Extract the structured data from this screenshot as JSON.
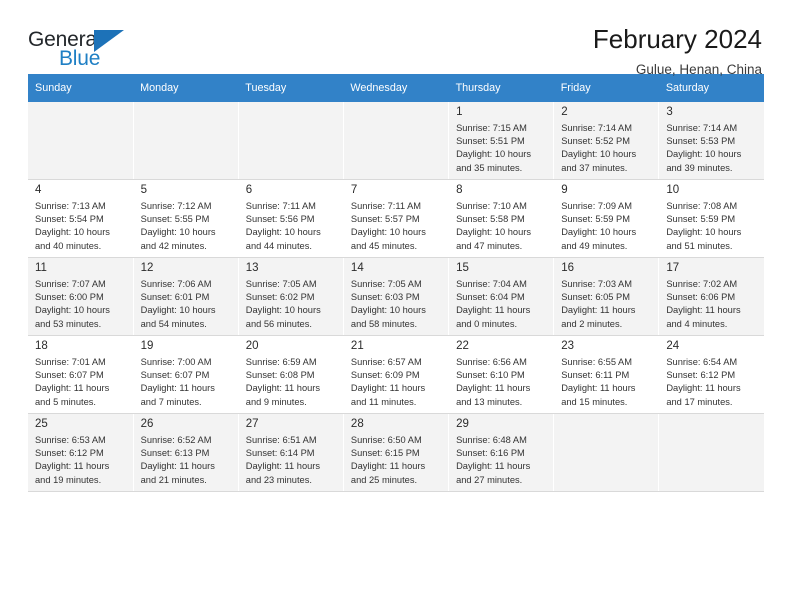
{
  "brand": {
    "name_top": "General",
    "name_bottom": "Blue",
    "accent_color": "#1f7fc4",
    "triangle_color": "#1d72b8"
  },
  "header": {
    "title": "February 2024",
    "subtitle": "Gulue, Henan, China"
  },
  "calendar": {
    "header_bg": "#3282c8",
    "weekdays": [
      "Sunday",
      "Monday",
      "Tuesday",
      "Wednesday",
      "Thursday",
      "Friday",
      "Saturday"
    ],
    "labels": {
      "sunrise": "Sunrise:",
      "sunset": "Sunset:",
      "daylight": "Daylight:"
    },
    "weeks": [
      [
        {
          "day": ""
        },
        {
          "day": ""
        },
        {
          "day": ""
        },
        {
          "day": ""
        },
        {
          "day": "1",
          "sunrise": "Sunrise: 7:15 AM",
          "sunset": "Sunset: 5:51 PM",
          "daylight1": "Daylight: 10 hours",
          "daylight2": "and 35 minutes."
        },
        {
          "day": "2",
          "sunrise": "Sunrise: 7:14 AM",
          "sunset": "Sunset: 5:52 PM",
          "daylight1": "Daylight: 10 hours",
          "daylight2": "and 37 minutes."
        },
        {
          "day": "3",
          "sunrise": "Sunrise: 7:14 AM",
          "sunset": "Sunset: 5:53 PM",
          "daylight1": "Daylight: 10 hours",
          "daylight2": "and 39 minutes."
        }
      ],
      [
        {
          "day": "4",
          "sunrise": "Sunrise: 7:13 AM",
          "sunset": "Sunset: 5:54 PM",
          "daylight1": "Daylight: 10 hours",
          "daylight2": "and 40 minutes."
        },
        {
          "day": "5",
          "sunrise": "Sunrise: 7:12 AM",
          "sunset": "Sunset: 5:55 PM",
          "daylight1": "Daylight: 10 hours",
          "daylight2": "and 42 minutes."
        },
        {
          "day": "6",
          "sunrise": "Sunrise: 7:11 AM",
          "sunset": "Sunset: 5:56 PM",
          "daylight1": "Daylight: 10 hours",
          "daylight2": "and 44 minutes."
        },
        {
          "day": "7",
          "sunrise": "Sunrise: 7:11 AM",
          "sunset": "Sunset: 5:57 PM",
          "daylight1": "Daylight: 10 hours",
          "daylight2": "and 45 minutes."
        },
        {
          "day": "8",
          "sunrise": "Sunrise: 7:10 AM",
          "sunset": "Sunset: 5:58 PM",
          "daylight1": "Daylight: 10 hours",
          "daylight2": "and 47 minutes."
        },
        {
          "day": "9",
          "sunrise": "Sunrise: 7:09 AM",
          "sunset": "Sunset: 5:59 PM",
          "daylight1": "Daylight: 10 hours",
          "daylight2": "and 49 minutes."
        },
        {
          "day": "10",
          "sunrise": "Sunrise: 7:08 AM",
          "sunset": "Sunset: 5:59 PM",
          "daylight1": "Daylight: 10 hours",
          "daylight2": "and 51 minutes."
        }
      ],
      [
        {
          "day": "11",
          "sunrise": "Sunrise: 7:07 AM",
          "sunset": "Sunset: 6:00 PM",
          "daylight1": "Daylight: 10 hours",
          "daylight2": "and 53 minutes."
        },
        {
          "day": "12",
          "sunrise": "Sunrise: 7:06 AM",
          "sunset": "Sunset: 6:01 PM",
          "daylight1": "Daylight: 10 hours",
          "daylight2": "and 54 minutes."
        },
        {
          "day": "13",
          "sunrise": "Sunrise: 7:05 AM",
          "sunset": "Sunset: 6:02 PM",
          "daylight1": "Daylight: 10 hours",
          "daylight2": "and 56 minutes."
        },
        {
          "day": "14",
          "sunrise": "Sunrise: 7:05 AM",
          "sunset": "Sunset: 6:03 PM",
          "daylight1": "Daylight: 10 hours",
          "daylight2": "and 58 minutes."
        },
        {
          "day": "15",
          "sunrise": "Sunrise: 7:04 AM",
          "sunset": "Sunset: 6:04 PM",
          "daylight1": "Daylight: 11 hours",
          "daylight2": "and 0 minutes."
        },
        {
          "day": "16",
          "sunrise": "Sunrise: 7:03 AM",
          "sunset": "Sunset: 6:05 PM",
          "daylight1": "Daylight: 11 hours",
          "daylight2": "and 2 minutes."
        },
        {
          "day": "17",
          "sunrise": "Sunrise: 7:02 AM",
          "sunset": "Sunset: 6:06 PM",
          "daylight1": "Daylight: 11 hours",
          "daylight2": "and 4 minutes."
        }
      ],
      [
        {
          "day": "18",
          "sunrise": "Sunrise: 7:01 AM",
          "sunset": "Sunset: 6:07 PM",
          "daylight1": "Daylight: 11 hours",
          "daylight2": "and 5 minutes."
        },
        {
          "day": "19",
          "sunrise": "Sunrise: 7:00 AM",
          "sunset": "Sunset: 6:07 PM",
          "daylight1": "Daylight: 11 hours",
          "daylight2": "and 7 minutes."
        },
        {
          "day": "20",
          "sunrise": "Sunrise: 6:59 AM",
          "sunset": "Sunset: 6:08 PM",
          "daylight1": "Daylight: 11 hours",
          "daylight2": "and 9 minutes."
        },
        {
          "day": "21",
          "sunrise": "Sunrise: 6:57 AM",
          "sunset": "Sunset: 6:09 PM",
          "daylight1": "Daylight: 11 hours",
          "daylight2": "and 11 minutes."
        },
        {
          "day": "22",
          "sunrise": "Sunrise: 6:56 AM",
          "sunset": "Sunset: 6:10 PM",
          "daylight1": "Daylight: 11 hours",
          "daylight2": "and 13 minutes."
        },
        {
          "day": "23",
          "sunrise": "Sunrise: 6:55 AM",
          "sunset": "Sunset: 6:11 PM",
          "daylight1": "Daylight: 11 hours",
          "daylight2": "and 15 minutes."
        },
        {
          "day": "24",
          "sunrise": "Sunrise: 6:54 AM",
          "sunset": "Sunset: 6:12 PM",
          "daylight1": "Daylight: 11 hours",
          "daylight2": "and 17 minutes."
        }
      ],
      [
        {
          "day": "25",
          "sunrise": "Sunrise: 6:53 AM",
          "sunset": "Sunset: 6:12 PM",
          "daylight1": "Daylight: 11 hours",
          "daylight2": "and 19 minutes."
        },
        {
          "day": "26",
          "sunrise": "Sunrise: 6:52 AM",
          "sunset": "Sunset: 6:13 PM",
          "daylight1": "Daylight: 11 hours",
          "daylight2": "and 21 minutes."
        },
        {
          "day": "27",
          "sunrise": "Sunrise: 6:51 AM",
          "sunset": "Sunset: 6:14 PM",
          "daylight1": "Daylight: 11 hours",
          "daylight2": "and 23 minutes."
        },
        {
          "day": "28",
          "sunrise": "Sunrise: 6:50 AM",
          "sunset": "Sunset: 6:15 PM",
          "daylight1": "Daylight: 11 hours",
          "daylight2": "and 25 minutes."
        },
        {
          "day": "29",
          "sunrise": "Sunrise: 6:48 AM",
          "sunset": "Sunset: 6:16 PM",
          "daylight1": "Daylight: 11 hours",
          "daylight2": "and 27 minutes."
        },
        {
          "day": ""
        },
        {
          "day": ""
        }
      ]
    ]
  }
}
